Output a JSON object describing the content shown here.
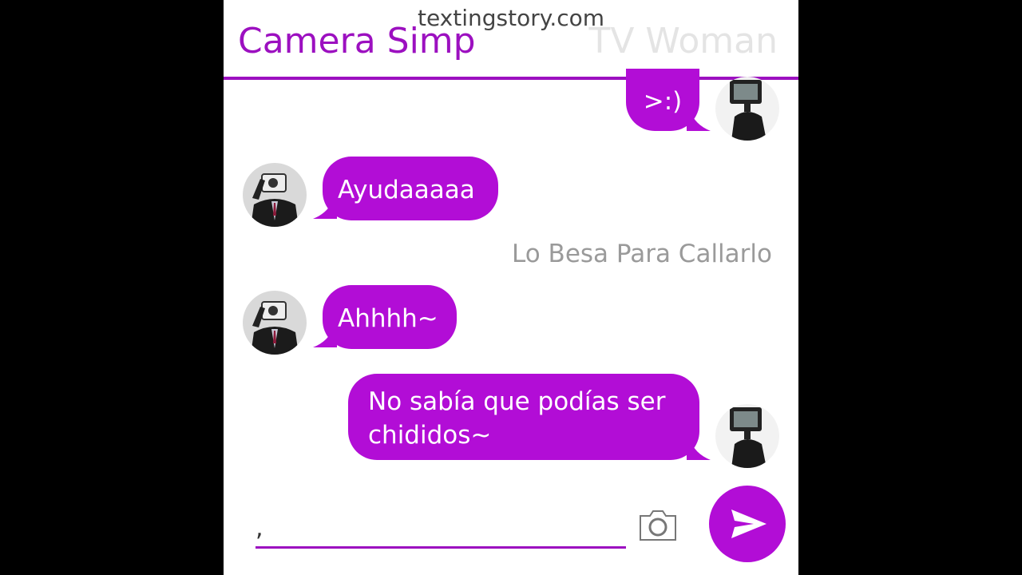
{
  "watermark": "textingstory.com",
  "header": {
    "left_contact": "Camera Simp",
    "right_contact": "TV Woman"
  },
  "messages": [
    {
      "sender": "TV Woman",
      "side": "right",
      "text": ">:)"
    },
    {
      "sender": "Camera Simp",
      "side": "left",
      "text": "Ayudaaaaa"
    },
    {
      "type": "narration",
      "text": "Lo Besa Para Callarlo"
    },
    {
      "sender": "Camera Simp",
      "side": "left",
      "text": "Ahhhh~"
    },
    {
      "sender": "TV Woman",
      "side": "right",
      "text": "No sabía que podías ser chididos~"
    }
  ],
  "input": {
    "value": ","
  },
  "icons": {
    "camera": "camera-icon",
    "send": "send-icon"
  },
  "colors": {
    "accent": "#9c10c0",
    "bubble": "#b20dd6",
    "right_contact": "#e4e4e4",
    "narration": "#9a9a9a"
  }
}
